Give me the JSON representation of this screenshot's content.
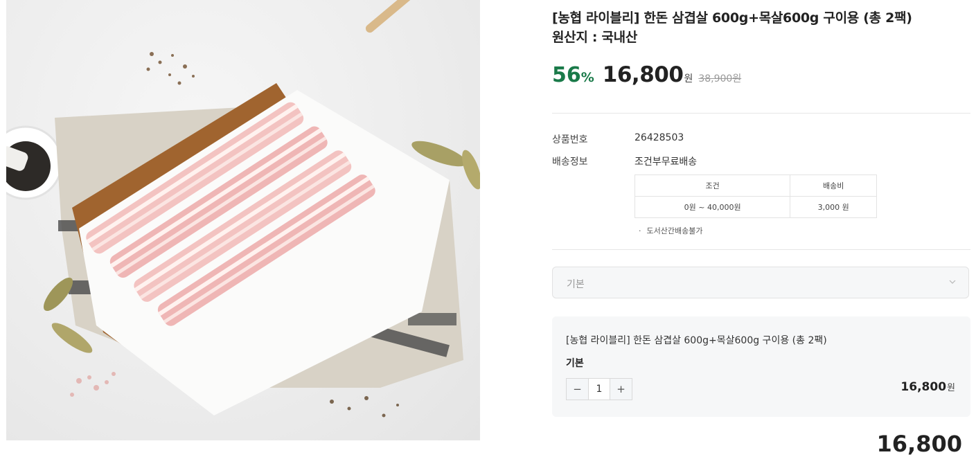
{
  "product": {
    "title_line1": "[농협 라이블리] 한돈 삼겹살 600g+목살600g 구이용 (총 2팩)",
    "title_line2": "원산지 : 국내산",
    "discount": "56",
    "discount_unit": "%",
    "price": "16,800",
    "currency": "원",
    "original_price": "38,900원"
  },
  "meta": {
    "product_number_label": "상품번호",
    "product_number": "26428503",
    "shipping_label": "배송정보",
    "shipping_value": "조건부무료배송",
    "table": {
      "headers": [
        "조건",
        "배송비"
      ],
      "rows": [
        [
          "0원 ~ 40,000원",
          "3,000 원"
        ]
      ]
    },
    "note": "도서산간배송불가"
  },
  "option_select": {
    "value": "기본"
  },
  "selected_option": {
    "name": "[농협 라이블리] 한돈 삼겹살 600g+목살600g 구이용 (총 2팩)",
    "option": "기본",
    "quantity": "1",
    "minus": "−",
    "plus": "+",
    "price": "16,800",
    "currency": "원"
  },
  "total_peek": "16,800",
  "icons": {
    "chevron": "chevron-down-icon"
  }
}
